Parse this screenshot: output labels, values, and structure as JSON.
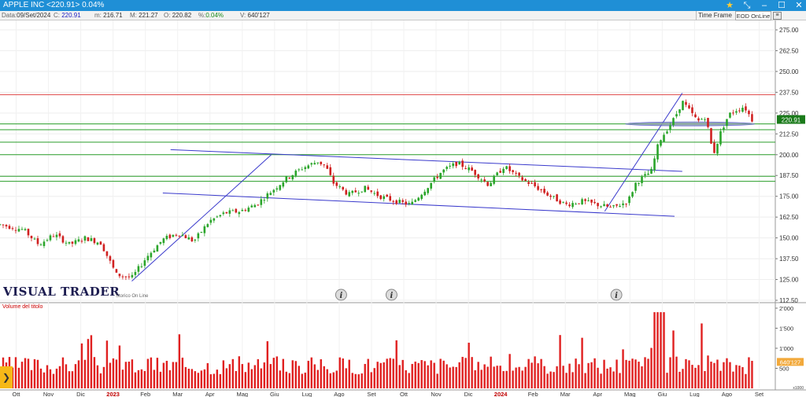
{
  "window": {
    "title": "APPLE INC <220.91> 0.04%",
    "controls": [
      "star-icon",
      "pin-icon",
      "minimize-icon",
      "maximize-icon",
      "close-icon"
    ],
    "accent_color": "#1f8fd6"
  },
  "infobar": {
    "date_label": "Data:",
    "date": "09/Set/2024",
    "close_label": "C:",
    "close": "220.91",
    "min_label": "m:",
    "min": "216.71",
    "max_label": "M:",
    "max": "221.27",
    "open_label": "O:",
    "open": "220.82",
    "pct_label": "%:",
    "pct": "0.04%",
    "vol_label": "V:",
    "vol": "640'127",
    "time_frame": "Time Frame",
    "eod": "EOD OnLine"
  },
  "watermark": {
    "brand": "VISUAL TRADER",
    "sub": "Storico On Line"
  },
  "volume_panel": {
    "label": "Volume del titolo",
    "last_value": "640'127",
    "unit_suffix": "x1000",
    "ticks": [
      "2'000",
      "1'500",
      "1'000",
      "500"
    ]
  },
  "chart_data": {
    "type": "candlestick",
    "symbol": "APPLE INC",
    "last_price_label": "220.91",
    "y_ticks": [
      "275.00",
      "262.50",
      "250.00",
      "237.50",
      "225.00",
      "212.50",
      "200.00",
      "187.50",
      "175.00",
      "162.50",
      "150.00",
      "137.50",
      "125.00",
      "112.50"
    ],
    "ylim": [
      112.5,
      275
    ],
    "x_labels": [
      "Ott",
      "Nov",
      "Dic",
      "2023",
      "Feb",
      "Mar",
      "Apr",
      "Mag",
      "Giu",
      "Lug",
      "Ago",
      "Set",
      "Ott",
      "Nov",
      "Dic",
      "2024",
      "Feb",
      "Mar",
      "Apr",
      "Mag",
      "Giu",
      "Lug",
      "Ago",
      "Set"
    ],
    "x_label_highlight": [
      "2023",
      "2024"
    ],
    "price_path": [
      [
        0,
        158
      ],
      [
        0.03,
        155
      ],
      [
        0.05,
        146
      ],
      [
        0.07,
        152
      ],
      [
        0.09,
        146
      ],
      [
        0.11,
        150
      ],
      [
        0.13,
        147
      ],
      [
        0.15,
        128
      ],
      [
        0.17,
        126
      ],
      [
        0.19,
        139
      ],
      [
        0.21,
        149
      ],
      [
        0.23,
        153
      ],
      [
        0.25,
        148
      ],
      [
        0.27,
        160
      ],
      [
        0.29,
        165
      ],
      [
        0.31,
        166
      ],
      [
        0.33,
        170
      ],
      [
        0.35,
        178
      ],
      [
        0.37,
        186
      ],
      [
        0.39,
        192
      ],
      [
        0.41,
        196
      ],
      [
        0.42,
        193
      ],
      [
        0.43,
        183
      ],
      [
        0.45,
        176
      ],
      [
        0.47,
        180
      ],
      [
        0.49,
        175
      ],
      [
        0.51,
        172
      ],
      [
        0.53,
        170
      ],
      [
        0.55,
        180
      ],
      [
        0.57,
        190
      ],
      [
        0.59,
        195
      ],
      [
        0.61,
        190
      ],
      [
        0.63,
        182
      ],
      [
        0.65,
        193
      ],
      [
        0.67,
        186
      ],
      [
        0.69,
        181
      ],
      [
        0.71,
        175
      ],
      [
        0.73,
        170
      ],
      [
        0.75,
        172
      ],
      [
        0.77,
        170
      ],
      [
        0.79,
        168
      ],
      [
        0.81,
        172
      ],
      [
        0.82,
        183
      ],
      [
        0.84,
        190
      ],
      [
        0.85,
        208
      ],
      [
        0.86,
        215
      ],
      [
        0.87,
        222
      ],
      [
        0.88,
        232
      ],
      [
        0.89,
        226
      ],
      [
        0.9,
        220
      ],
      [
        0.91,
        223
      ],
      [
        0.92,
        200
      ],
      [
        0.93,
        214
      ],
      [
        0.94,
        224
      ],
      [
        0.95,
        227
      ],
      [
        0.96,
        229
      ],
      [
        0.97,
        221
      ]
    ],
    "horizontal_levels": [
      {
        "value": 236,
        "color": "#e05050"
      },
      {
        "value": 218.5,
        "color": "#2a9e2a"
      },
      {
        "value": 215,
        "color": "#2a9e2a"
      },
      {
        "value": 207.5,
        "color": "#2a9e2a"
      },
      {
        "value": 200,
        "color": "#2a9e2a"
      },
      {
        "value": 187,
        "color": "#2a9e2a"
      },
      {
        "value": 184,
        "color": "#2a9e2a"
      }
    ],
    "trendlines": [
      {
        "x1": 0.22,
        "y1": 203,
        "x2": 0.88,
        "y2": 190
      },
      {
        "x1": 0.21,
        "y1": 177,
        "x2": 0.87,
        "y2": 163
      },
      {
        "x1": 0.17,
        "y1": 124,
        "x2": 0.35,
        "y2": 200
      },
      {
        "x1": 0.78,
        "y1": 166,
        "x2": 0.88,
        "y2": 237
      }
    ],
    "info_markers_x": [
      0.44,
      0.505,
      0.795
    ],
    "colors": {
      "up": "#2aa52a",
      "down": "#d02020",
      "trend": "#3a3acc",
      "volume": "#e02020",
      "price_badge": "#1a7a1a"
    }
  }
}
